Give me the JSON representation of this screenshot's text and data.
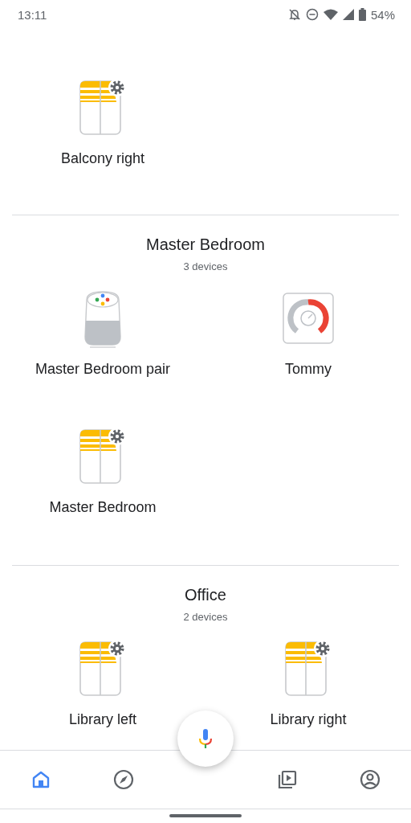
{
  "status_bar": {
    "time": "13:11",
    "battery": "54%"
  },
  "sections": [
    {
      "devices": [
        {
          "name": "Balcony right",
          "kind": "blind"
        }
      ]
    },
    {
      "title": "Master Bedroom",
      "subtitle": "3 devices",
      "devices": [
        {
          "name": "Master Bedroom pair",
          "kind": "speaker"
        },
        {
          "name": "Tommy",
          "kind": "thermostat"
        },
        {
          "name": "Master Bedroom",
          "kind": "blind"
        }
      ]
    },
    {
      "title": "Office",
      "subtitle": "2 devices",
      "devices": [
        {
          "name": "Library left",
          "kind": "blind"
        },
        {
          "name": "Library right",
          "kind": "blind"
        }
      ]
    }
  ],
  "nav": [
    {
      "kind": "home",
      "selected": true
    },
    {
      "kind": "explore",
      "selected": false
    },
    {
      "kind": "media",
      "selected": false
    },
    {
      "kind": "account",
      "selected": false
    }
  ]
}
